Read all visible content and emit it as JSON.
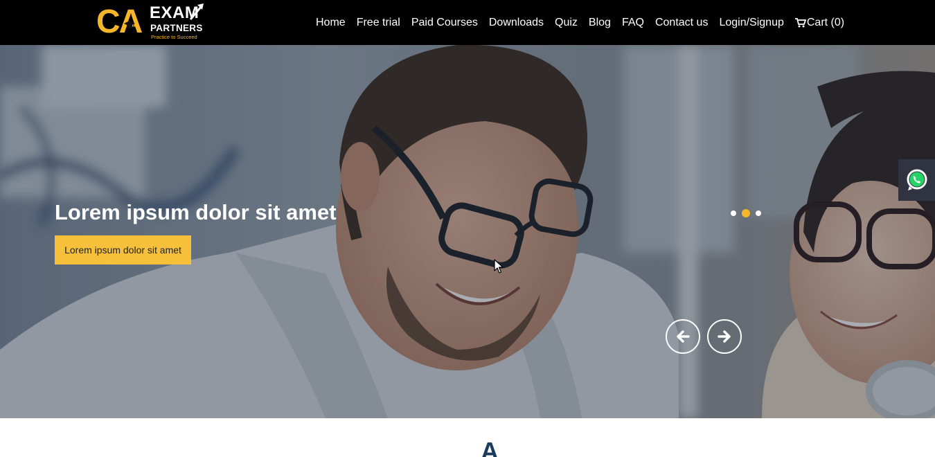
{
  "brand": {
    "logo_ca": "CA",
    "logo_exam": "EXAM",
    "logo_partners": "PARTNERS",
    "logo_tagline": "Practice to Succeed",
    "logo_color": "#f6b629",
    "logo_text_color": "#ffffff",
    "tagline_color": "#f6b629"
  },
  "nav": {
    "items": [
      "Home",
      "Free trial",
      "Paid Courses",
      "Downloads",
      "Quiz",
      "Blog",
      "FAQ",
      "Contact us",
      "Login/Signup"
    ],
    "cart_label": "Cart (0)",
    "cart_icon": "shopping-cart-icon"
  },
  "hero": {
    "title": "Lorem ipsum dolor sit amet",
    "button_label": "Lorem ipsum dolor sit amet",
    "button_color": "#f6c03a",
    "slides_total": 3,
    "active_slide": 2,
    "prev_icon": "arrow-left-icon",
    "next_icon": "arrow-right-icon"
  },
  "floating": {
    "whatsapp_icon": "whatsapp-icon"
  },
  "next_section": {
    "heading_peek": "A",
    "heading_color": "#1b3a5c"
  },
  "colors": {
    "navbar_bg": "#000000",
    "accent": "#f6b629",
    "whatsapp_bg": "#2f3440",
    "whatsapp_green": "#25d366"
  }
}
